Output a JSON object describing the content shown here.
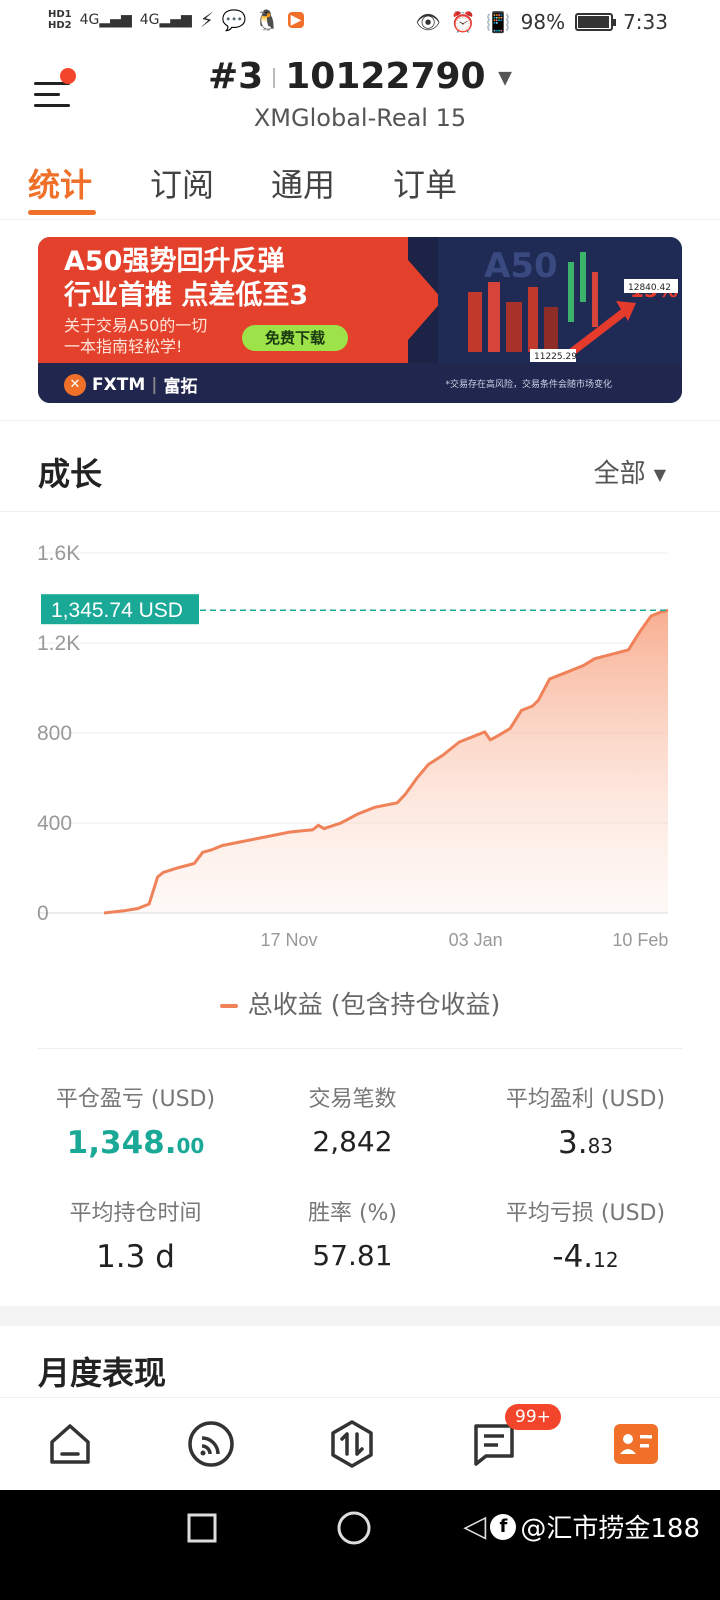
{
  "status_bar": {
    "hd1": "HD1",
    "hd2": "HD2",
    "signal1": "4G",
    "signal2": "4G",
    "battery": "98%",
    "battery_level": 0.98,
    "time": "7:33"
  },
  "header": {
    "account_prefix": "#3",
    "account_number": "10122790",
    "server": "XMGlobal-Real 15"
  },
  "tabs": [
    "统计",
    "订阅",
    "通用",
    "订单"
  ],
  "banner": {
    "headline1": "A50强势回升反弹",
    "headline2": "行业首推 点差低至3",
    "sub1": "关于交易A50的一切",
    "sub2": "一本指南轻松学!",
    "button": "免费下载",
    "brand": "FXTM",
    "brand_cn": "富拓",
    "disclaimer": "*交易存在高风险，交易条件会随市场变化",
    "art_text": "A50",
    "price_high": "12840.42",
    "price_low": "11225.29",
    "percent": "15%"
  },
  "growth": {
    "title": "成长",
    "filter": "全部"
  },
  "chart_data": {
    "type": "area",
    "current_label": "1,345.74 USD",
    "current_value": 1345.74,
    "yticks": [
      "0",
      "400",
      "800",
      "1.2K",
      "1.6K"
    ],
    "ytick_values": [
      0,
      400,
      800,
      1200,
      1600
    ],
    "xticks": [
      "17 Nov",
      "03 Jan",
      "10 Feb"
    ],
    "xtick_positions": [
      0.328,
      0.659,
      0.951
    ],
    "ylim": [
      0,
      1600
    ],
    "legend": "总收益 (包含持仓收益)",
    "color": "#f0825a",
    "series": [
      {
        "values": [
          [
            0.0,
            0
          ],
          [
            0.035,
            10
          ],
          [
            0.06,
            20
          ],
          [
            0.08,
            40
          ],
          [
            0.095,
            160
          ],
          [
            0.105,
            180
          ],
          [
            0.13,
            200
          ],
          [
            0.16,
            220
          ],
          [
            0.175,
            270
          ],
          [
            0.19,
            280
          ],
          [
            0.21,
            300
          ],
          [
            0.25,
            320
          ],
          [
            0.29,
            340
          ],
          [
            0.33,
            360
          ],
          [
            0.37,
            370
          ],
          [
            0.38,
            390
          ],
          [
            0.39,
            375
          ],
          [
            0.42,
            400
          ],
          [
            0.45,
            440
          ],
          [
            0.48,
            470
          ],
          [
            0.52,
            490
          ],
          [
            0.535,
            530
          ],
          [
            0.555,
            600
          ],
          [
            0.575,
            660
          ],
          [
            0.6,
            700
          ],
          [
            0.63,
            760
          ],
          [
            0.66,
            790
          ],
          [
            0.675,
            805
          ],
          [
            0.685,
            770
          ],
          [
            0.7,
            790
          ],
          [
            0.72,
            820
          ],
          [
            0.74,
            900
          ],
          [
            0.76,
            920
          ],
          [
            0.77,
            945
          ],
          [
            0.79,
            1040
          ],
          [
            0.82,
            1070
          ],
          [
            0.85,
            1100
          ],
          [
            0.87,
            1130
          ],
          [
            0.9,
            1150
          ],
          [
            0.93,
            1170
          ],
          [
            0.95,
            1250
          ],
          [
            0.97,
            1320
          ],
          [
            0.985,
            1335
          ],
          [
            1.0,
            1345.74
          ]
        ]
      }
    ]
  },
  "stats": [
    {
      "label": "平仓盈亏 (USD)",
      "int": "1,348.",
      "dec": "00"
    },
    {
      "label": "交易笔数",
      "int": "2,842",
      "dec": ""
    },
    {
      "label": "平均盈利 (USD)",
      "int": "3.",
      "dec": "83"
    },
    {
      "label": "平均持仓时间",
      "int": "1.3 d",
      "dec": ""
    },
    {
      "label": "胜率 (%)",
      "int": "57.81",
      "dec": ""
    },
    {
      "label": "平均亏损 (USD)",
      "int": "-4.",
      "dec": "12"
    }
  ],
  "monthly": {
    "title": "月度表现"
  },
  "bottom_nav": {
    "badge": "99+"
  },
  "watermark": "@汇市捞金188"
}
